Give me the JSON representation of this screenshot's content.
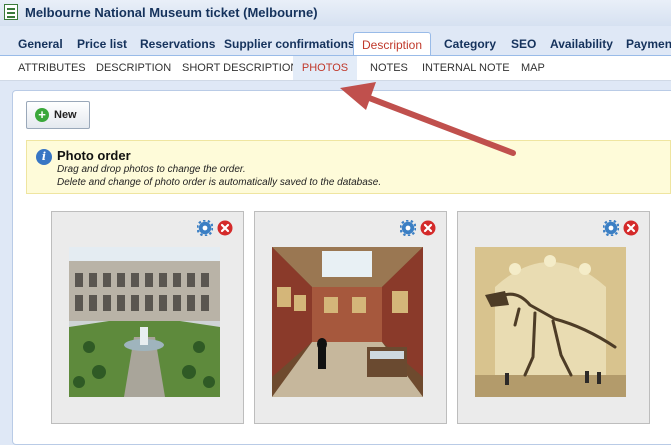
{
  "window": {
    "title": "Melbourne National Museum ticket (Melbourne)"
  },
  "tabs": [
    "General",
    "Price list",
    "Reservations",
    "Supplier confirmations",
    "Description",
    "Category",
    "SEO",
    "Availability",
    "Payment"
  ],
  "active_tab": "Description",
  "subtabs": [
    "ATTRIBUTES",
    "DESCRIPTION",
    "SHORT DESCRIPTION",
    "PHOTOS",
    "NOTES",
    "INTERNAL NOTE",
    "MAP"
  ],
  "active_subtab": "PHOTOS",
  "toolbar": {
    "new_label": "New"
  },
  "info": {
    "title": "Photo order",
    "line1": "Drag and drop photos to change the order.",
    "line2": "Delete and change of photo order is automatically saved to the database."
  },
  "photos": [
    {
      "name": "courtyard-photo"
    },
    {
      "name": "gallery-photo"
    },
    {
      "name": "dinosaur-photo"
    }
  ],
  "colors": {
    "accent": "#c0392b",
    "arrow": "#c0504d",
    "info_bg": "#fefbd9"
  }
}
